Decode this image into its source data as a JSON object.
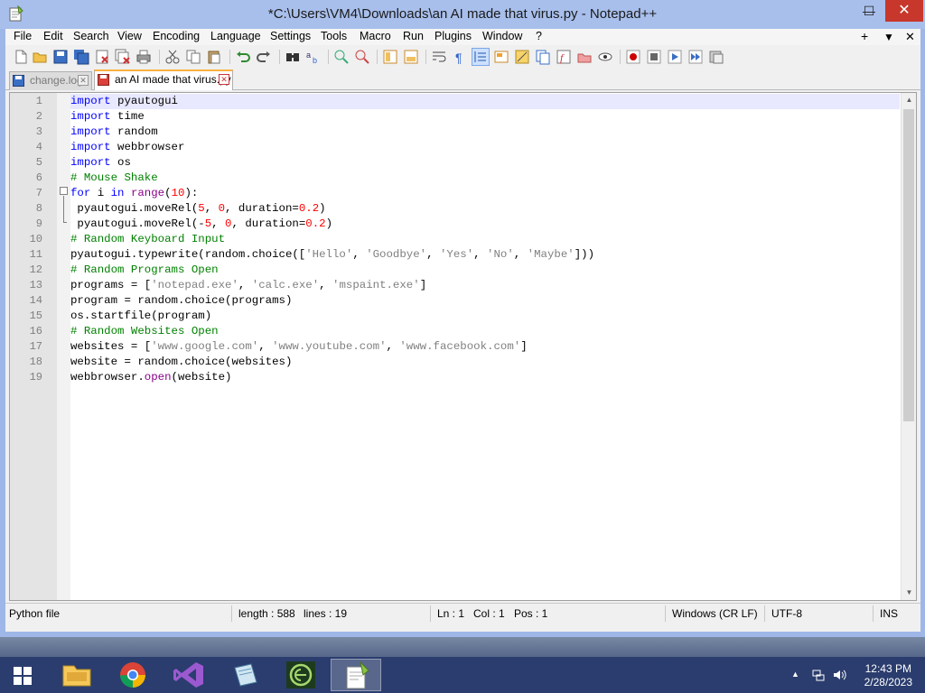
{
  "window": {
    "title": "*C:\\Users\\VM4\\Downloads\\an AI made that virus.py - Notepad++",
    "minimize_glyph": "—",
    "maximize_glyph": "☐",
    "close_glyph": "✕"
  },
  "menu": {
    "items": [
      "File",
      "Edit",
      "Search",
      "View",
      "Encoding",
      "Language",
      "Settings",
      "Tools",
      "Macro",
      "Run",
      "Plugins",
      "Window",
      "?"
    ],
    "right_plus": "+",
    "right_dropdown": "▼",
    "right_close": "✕"
  },
  "tabs": [
    {
      "label": "change.log",
      "active": false
    },
    {
      "label": "an AI made that virus.py",
      "active": true
    }
  ],
  "editor": {
    "line_numbers": [
      "1",
      "2",
      "3",
      "4",
      "5",
      "6",
      "7",
      "8",
      "9",
      "10",
      "11",
      "12",
      "13",
      "14",
      "15",
      "16",
      "17",
      "18",
      "19"
    ]
  },
  "statusbar": {
    "file_type": "Python file",
    "length": "length : 588",
    "lines": "lines : 19",
    "ln": "Ln : 1",
    "col": "Col : 1",
    "pos": "Pos : 1",
    "eol": "Windows (CR LF)",
    "encoding": "UTF-8",
    "mode": "INS"
  },
  "taskbar": {
    "apps": [
      "file-explorer",
      "chrome",
      "visual-studio",
      "notepad",
      "code-editor",
      "notepad-plus-plus"
    ],
    "time": "12:43 PM",
    "date": "2/28/2023"
  },
  "colors": {
    "keyword": "#0000ff",
    "builtin": "#880088",
    "number": "#ff0000",
    "string": "#808080",
    "comment": "#008000",
    "close_button": "#c7372c",
    "taskbar": "#2b3d6e"
  }
}
